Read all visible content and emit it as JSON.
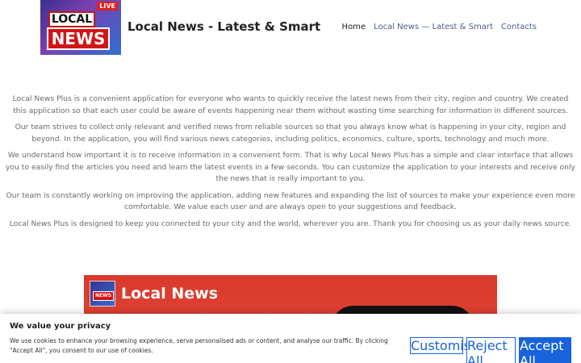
{
  "logo": {
    "live": "LIVE",
    "line1": "LOCAL",
    "line2": "NEWS"
  },
  "site_title": "Local News - Latest & Smart",
  "nav": {
    "home": "Home",
    "local": "Local News — Latest & Smart",
    "contacts": "Contacts"
  },
  "content": {
    "p1": "Local News Plus is a convenient application for everyone who wants to quickly receive the latest news from their city, region and country. We created this application so that each user could be aware of events happening near them without wasting time searching for information in different sources.",
    "p2": "Our team strives to collect only relevant and verified news from reliable sources so that you always know what is happening in your city, region and beyond. In the application, you will find various news categories, including politics, economics, culture, sports, technology and much more.",
    "p3": "We understand how important it is to receive information in a convenient form. That is why Local News Plus has a simple and clear interface that allows you to easily find the articles you need and learn the latest events in a few seconds. You can customize the application to your interests and receive only the news that is really important to you.",
    "p4": "Our team is constantly working on improving the application, adding new features and expanding the list of sources to make your experience even more comfortable. We value each user and are always open to your suggestions and feedback.",
    "p5": "Local News Plus is designed to keep you connected to your city and the world, wherever you are. Thank you for choosing us as your daily news source."
  },
  "banner": {
    "title": "Local News",
    "mini": "NEWS"
  },
  "cookie": {
    "title": "We value your privacy",
    "text": "We use cookies to enhance your browsing experience, serve personalised ads or content, and analyse our traffic. By clicking \"Accept All\", you consent to our use of cookies.",
    "customise": "Customise",
    "reject": "Reject All",
    "accept": "Accept All"
  }
}
